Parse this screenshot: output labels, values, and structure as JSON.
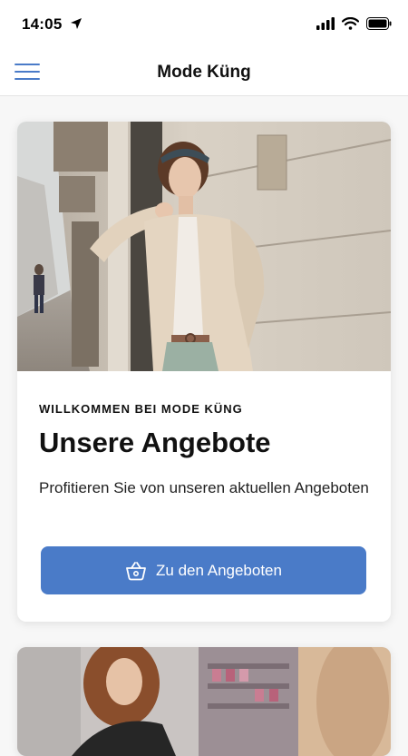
{
  "status": {
    "time": "14:05"
  },
  "nav": {
    "title": "Mode Küng"
  },
  "cards": [
    {
      "eyebrow": "WILLKOMMEN BEI MODE KÜNG",
      "headline": "Unsere Angebote",
      "description": "Profitieren Sie von unseren aktuellen Angeboten",
      "cta_label": "Zu den Angeboten",
      "cta_icon": "basket-icon"
    }
  ],
  "colors": {
    "accent": "#4a7bc8",
    "background": "#f7f7f7"
  }
}
